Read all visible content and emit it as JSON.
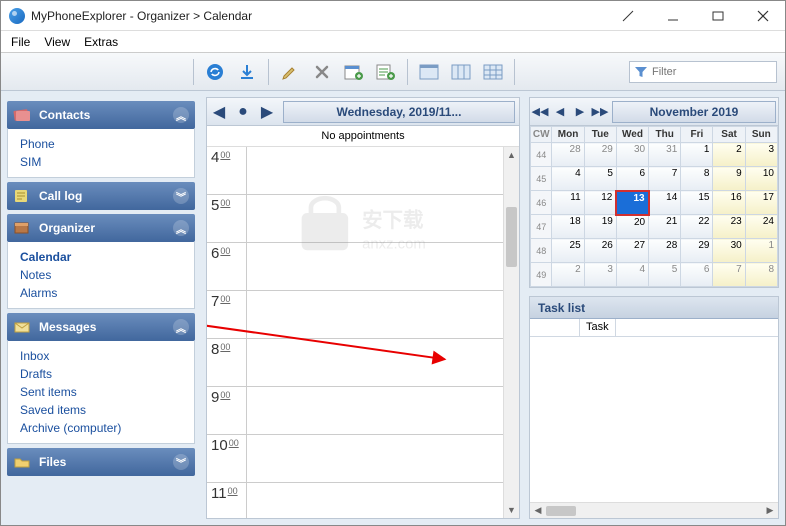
{
  "window": {
    "title": "MyPhoneExplorer -   Organizer > Calendar"
  },
  "menu": [
    "File",
    "View",
    "Extras"
  ],
  "filter": {
    "placeholder": "Filter"
  },
  "sidebar": {
    "contacts": {
      "label": "Contacts",
      "items": [
        "Phone",
        "SIM"
      ]
    },
    "calllog": {
      "label": "Call log"
    },
    "organizer": {
      "label": "Organizer",
      "items": [
        "Calendar",
        "Notes",
        "Alarms"
      ],
      "selected": 0
    },
    "messages": {
      "label": "Messages",
      "items": [
        "Inbox",
        "Drafts",
        "Sent items",
        "Saved items",
        "Archive (computer)"
      ]
    },
    "files": {
      "label": "Files"
    }
  },
  "day": {
    "date_label": "Wednesday, 2019/11...",
    "no_appt": "No appointments",
    "hours": [
      "4",
      "5",
      "6",
      "7",
      "8",
      "9",
      "10",
      "11"
    ],
    "minute_label": "00"
  },
  "month": {
    "label": "November 2019",
    "dow": [
      "CW",
      "Mon",
      "Tue",
      "Wed",
      "Thu",
      "Fri",
      "Sat",
      "Sun"
    ],
    "weeks": [
      {
        "cw": "44",
        "d": [
          "28",
          "29",
          "30",
          "31",
          "1",
          "2",
          "3"
        ],
        "other": [
          0,
          1,
          2,
          3
        ]
      },
      {
        "cw": "45",
        "d": [
          "4",
          "5",
          "6",
          "7",
          "8",
          "9",
          "10"
        ]
      },
      {
        "cw": "46",
        "d": [
          "11",
          "12",
          "13",
          "14",
          "15",
          "16",
          "17"
        ],
        "today": 2
      },
      {
        "cw": "47",
        "d": [
          "18",
          "19",
          "20",
          "21",
          "22",
          "23",
          "24"
        ]
      },
      {
        "cw": "48",
        "d": [
          "25",
          "26",
          "27",
          "28",
          "29",
          "30",
          "1"
        ],
        "other": [
          6
        ]
      },
      {
        "cw": "49",
        "d": [
          "2",
          "3",
          "4",
          "5",
          "6",
          "7",
          "8"
        ],
        "other": [
          0,
          1,
          2,
          3,
          4,
          5,
          6
        ]
      }
    ]
  },
  "tasks": {
    "header": "Task list",
    "col": "Task"
  },
  "watermark": "安下载 anxz.com"
}
